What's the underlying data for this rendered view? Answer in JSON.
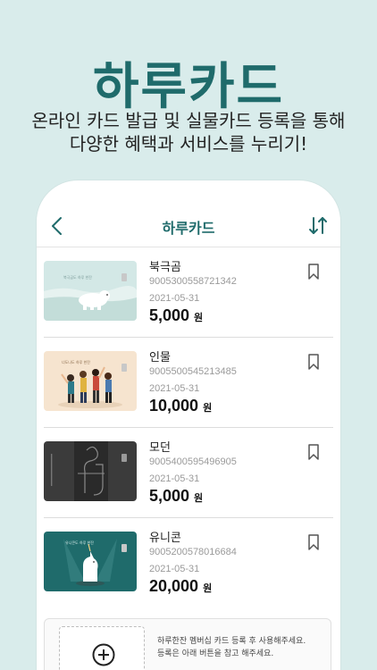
{
  "hero": {
    "title": "하루카드",
    "subtitle_line1": "온라인 카드 발급 및 실물카드 등록을 통해",
    "subtitle_line2": "다양한 혜택과 서비스를 누리기!"
  },
  "header": {
    "title": "하루카드",
    "back_icon": "chevron-left-icon",
    "sort_icon": "sort-arrows-icon"
  },
  "cards": [
    {
      "name": "북극곰",
      "number": "9005300558721342",
      "date": "2021-05-31",
      "amount": "5,000",
      "unit": "원",
      "art": "polar-bear",
      "art_text": "북극곰도 하루 한잔"
    },
    {
      "name": "인물",
      "number": "9005500545213485",
      "date": "2021-05-31",
      "amount": "10,000",
      "unit": "원",
      "art": "people",
      "art_text": "너도나도 하루 한잔"
    },
    {
      "name": "모던",
      "number": "9005400595496905",
      "date": "2021-05-31",
      "amount": "5,000",
      "unit": "원",
      "art": "modern"
    },
    {
      "name": "유니콘",
      "number": "9005200578016684",
      "date": "2021-05-31",
      "amount": "20,000",
      "unit": "원",
      "art": "unicorn",
      "art_text": "유니콘도 하루 한잔"
    }
  ],
  "add_card": {
    "description_line1": "하루한잔 멤버십 카드 등록 후 사용해주세요.",
    "description_line2": "등록은 아래 버튼을 참고 해주세요."
  },
  "colors": {
    "background": "#d9eceb",
    "accent": "#1f6b6b"
  }
}
